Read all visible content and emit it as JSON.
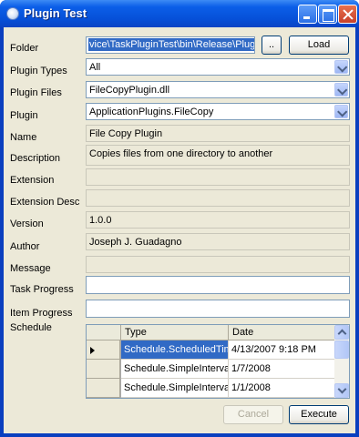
{
  "window": {
    "title": "Plugin Test"
  },
  "labels": {
    "folder": "Folder",
    "plugin_types": "Plugin Types",
    "plugin_files": "Plugin Files",
    "plugin": "Plugin",
    "name": "Name",
    "description": "Description",
    "extension": "Extension",
    "extension_desc": "Extension Desc",
    "version": "Version",
    "author": "Author",
    "message": "Message",
    "task_progress": "Task Progress",
    "item_progress": "Item Progress",
    "schedule": "Schedule"
  },
  "fields": {
    "folder": "vice\\TaskPluginTest\\bin\\Release\\Plugins",
    "plugin_types": "All",
    "plugin_files": "FileCopyPlugin.dll",
    "plugin": "ApplicationPlugins.FileCopy",
    "name": "File Copy Plugin",
    "description": "Copies files from one directory to another",
    "extension": "",
    "extension_desc": "",
    "version": "1.0.0",
    "author": "Joseph J. Guadagno",
    "message": ""
  },
  "buttons": {
    "browse": "..",
    "load": "Load",
    "cancel": "Cancel",
    "execute": "Execute"
  },
  "schedule": {
    "columns": [
      "Type",
      "Date"
    ],
    "rows": [
      {
        "type": "Schedule.ScheduledTime",
        "date": "4/13/2007 9:18 PM"
      },
      {
        "type": "Schedule.SimpleInterval",
        "date": "1/7/2008"
      },
      {
        "type": "Schedule.SimpleInterval",
        "date": "1/1/2008"
      }
    ]
  }
}
